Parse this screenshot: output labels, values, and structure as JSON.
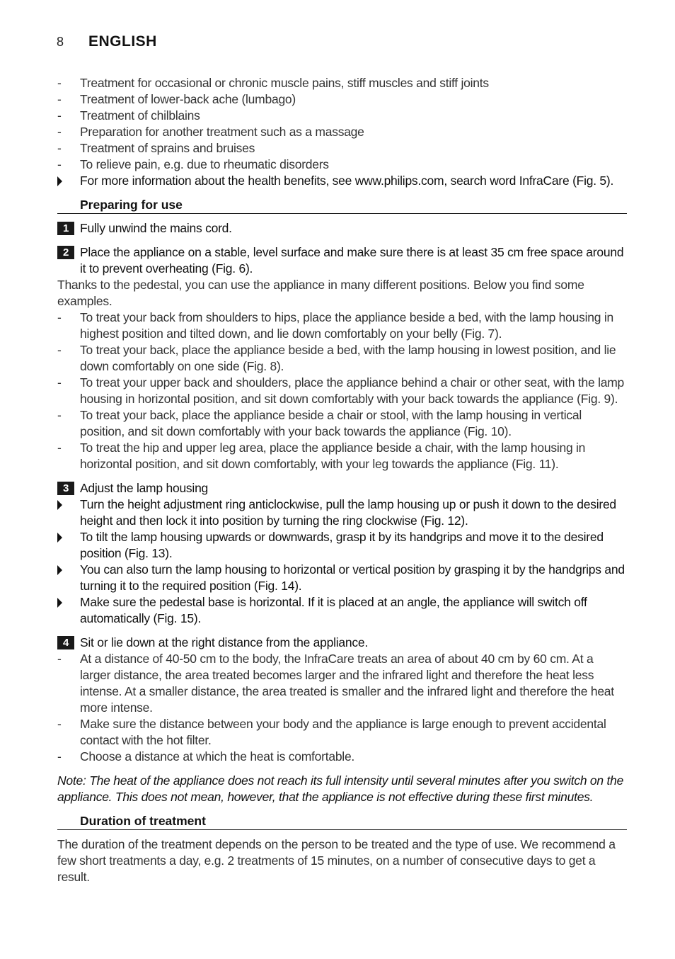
{
  "header": {
    "page_number": "8",
    "language": "ENGLISH"
  },
  "intro_dash_items": [
    "Treatment for occasional or chronic muscle pains, stiff muscles and stiff joints",
    "Treatment of lower-back ache (lumbago)",
    "Treatment of chilblains",
    "Preparation for another treatment such as a massage",
    "Treatment of sprains and bruises",
    "To relieve pain, e.g. due to rheumatic disorders"
  ],
  "intro_bullet": "For more information about the health benefits, see www.philips.com, search word InfraCare (Fig. 5).",
  "preparing": {
    "heading": "Preparing for use",
    "step1": {
      "num": "1",
      "text": "Fully unwind the mains cord."
    },
    "step2": {
      "num": "2",
      "text": "Place the appliance on a stable, level surface and make sure there is at least 35 cm free space around it to prevent overheating (Fig. 6)."
    },
    "positions_intro": "Thanks to the pedestal, you can use the appliance in many different positions. Below you find some examples.",
    "positions": [
      "To treat your back from shoulders to hips, place the appliance beside a bed, with the lamp housing in highest position and tilted down, and lie down comfortably on your belly (Fig. 7).",
      "To treat your back, place the appliance beside a bed, with the lamp housing in lowest position, and lie down comfortably on one side (Fig. 8).",
      "To treat your upper back and shoulders, place the appliance behind a chair or other seat, with the lamp housing in horizontal position, and sit down comfortably with your back towards the appliance (Fig. 9).",
      "To treat your back, place the appliance beside a chair or stool, with the lamp housing in vertical position, and sit down comfortably with your back towards the appliance (Fig. 10).",
      "To treat the hip and upper leg area, place the appliance beside a chair, with the lamp housing in horizontal position, and sit down comfortably, with your leg towards the appliance (Fig. 11)."
    ],
    "step3": {
      "num": "3",
      "text": "Adjust the lamp housing",
      "bullets": [
        "Turn the height adjustment ring anticlockwise, pull the lamp housing up or push it down to the desired height and then lock it into position by turning the ring clockwise (Fig. 12).",
        "To tilt the lamp housing upwards or downwards, grasp it by its handgrips and move it to the desired position (Fig. 13).",
        "You can also turn the lamp housing to horizontal or vertical position by grasping it by the handgrips and turning it to the required position (Fig. 14).",
        "Make sure the pedestal base is horizontal. If it is placed at an angle, the appliance will switch off automatically (Fig. 15)."
      ]
    },
    "step4": {
      "num": "4",
      "text": "Sit or lie down at the right distance from the appliance.",
      "dash_items": [
        "At a distance of 40-50 cm to the body, the InfraCare treats an area of about 40 cm by 60 cm. At a larger distance, the area treated becomes larger and the infrared light and therefore the heat less intense. At a smaller distance, the area treated is smaller and the infrared light and therefore the heat more intense.",
        "Make sure the distance between your body and the appliance is large enough to prevent accidental contact with the hot filter.",
        "Choose a distance at which the heat is comfortable."
      ]
    },
    "note": "Note: The heat of the appliance does not reach its full intensity until several minutes after you switch on the appliance. This does not mean, however, that the appliance is not effective during these first minutes."
  },
  "duration": {
    "heading": "Duration of treatment",
    "text": "The duration of the treatment depends on the person to be treated and the type of use. We recommend a few short treatments a day, e.g. 2 treatments of 15 minutes, on a number of consecutive days to get a result."
  }
}
